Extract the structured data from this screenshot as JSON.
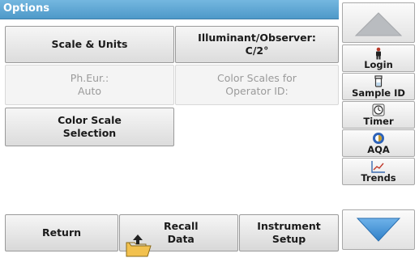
{
  "header": {
    "title": "Options"
  },
  "options": {
    "scale_units": "Scale & Units",
    "illuminant": "Illuminant/Observer:\nC/2°",
    "ph_eur": "Ph.Eur.:\nAuto",
    "color_scales_operator": "Color Scales for\nOperator ID:",
    "color_scale_selection": "Color Scale\nSelection"
  },
  "sidebar": {
    "items": [
      {
        "label": "Login",
        "icon": "person-icon"
      },
      {
        "label": "Sample ID",
        "icon": "sample-vial-icon"
      },
      {
        "label": "Timer",
        "icon": "timer-icon"
      },
      {
        "label": "AQA",
        "icon": "aqa-icon"
      },
      {
        "label": "Trends",
        "icon": "trends-chart-icon"
      }
    ]
  },
  "footer": {
    "return_label": "Return",
    "recall_label": "Recall\nData",
    "instrument_label": "Instrument\nSetup"
  },
  "colors": {
    "title_bar": "#5ba6d4",
    "arrow_blue": "#3e8fd0",
    "arrow_gray": "#b9bcc0"
  }
}
